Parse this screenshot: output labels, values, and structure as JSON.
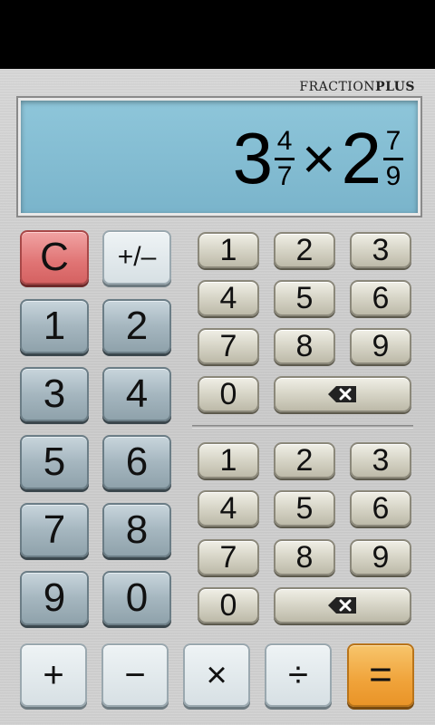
{
  "app": {
    "brand_light": "FRACTION",
    "brand_bold": "PLUS"
  },
  "display": {
    "left_whole": "3",
    "left_num": "4",
    "left_den": "7",
    "operator": "×",
    "right_whole": "2",
    "right_num": "7",
    "right_den": "9"
  },
  "main_keys": {
    "clear": "C",
    "sign": "+/–",
    "d1": "1",
    "d2": "2",
    "d3": "3",
    "d4": "4",
    "d5": "5",
    "d6": "6",
    "d7": "7",
    "d8": "8",
    "d9": "9",
    "d0": "0"
  },
  "numerator_keys": [
    "1",
    "2",
    "3",
    "4",
    "5",
    "6",
    "7",
    "8",
    "9",
    "0"
  ],
  "denominator_keys": [
    "1",
    "2",
    "3",
    "4",
    "5",
    "6",
    "7",
    "8",
    "9",
    "0"
  ],
  "operators": {
    "add": "+",
    "sub": "−",
    "mul": "×",
    "div": "÷",
    "eq": "="
  },
  "icons": {
    "backspace": "backspace-icon"
  },
  "colors": {
    "display_bg": "#8ec6da",
    "clear_button": "#e07474",
    "equals_button": "#f0a33a"
  }
}
